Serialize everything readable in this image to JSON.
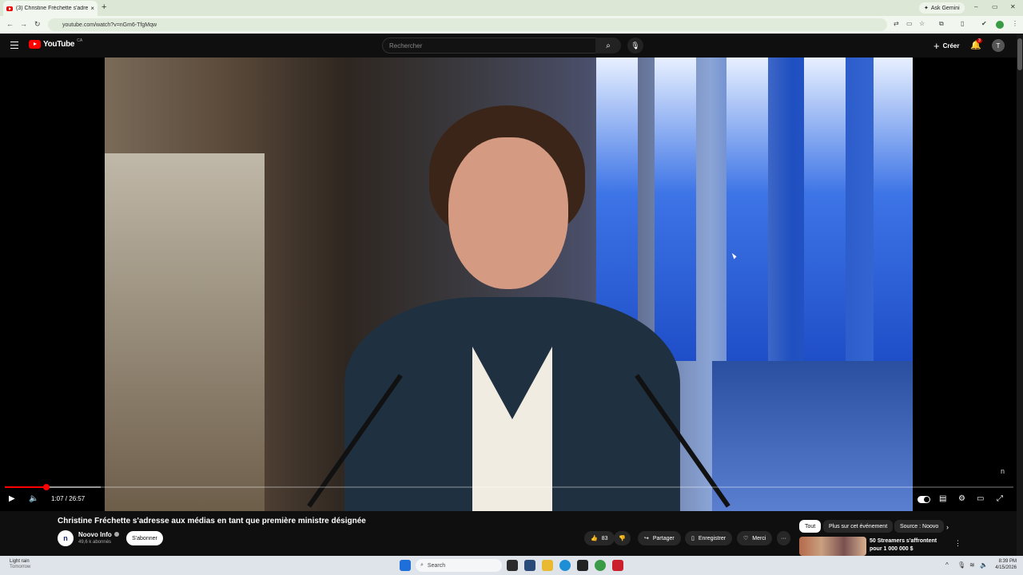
{
  "browser": {
    "tab_title": "(3) Christine Fréchette s'adresse",
    "tab_close": "×",
    "new_tab": "+",
    "ask_gemini": "Ask Gemini",
    "url": "youtube.com/watch?v=nGm6-TfgMqw",
    "minimize": "–",
    "maximize": "▭",
    "close": "✕",
    "profile_initial": "T"
  },
  "youtube": {
    "logo_text": "YouTube",
    "country": "CA",
    "search_placeholder": "Rechercher",
    "create_label": "Créer",
    "notification_count": "3",
    "avatar_initial": "T"
  },
  "player": {
    "time_display": "1:07 / 26:57",
    "progress_fraction": 0.041,
    "buffer_fraction": 0.095,
    "watermark": "n"
  },
  "video": {
    "title": "Christine Fréchette s'adresse aux médias en tant que première ministre désignée",
    "channel_initial": "n",
    "channel_name": "Noovo Info",
    "subscribers": "49,6 k abonnés",
    "subscribe_label": "S'abonner",
    "like_count": "83",
    "share_label": "Partager",
    "save_label": "Enregistrer",
    "thanks_label": "Merci",
    "more_label": "···"
  },
  "chips": [
    {
      "label": "Tout",
      "active": true
    },
    {
      "label": "Plus sur cet événement",
      "active": false
    },
    {
      "label": "Source : Noovo",
      "active": false
    }
  ],
  "recommendation": {
    "title": "50 Streamers s'affrontent pour 1 000 000 $"
  },
  "taskbar": {
    "weather_line1": "Light rain",
    "weather_line2": "Tomorrow",
    "search_label": "Search",
    "time": "8:39 PM",
    "date": "4/15/2026"
  }
}
